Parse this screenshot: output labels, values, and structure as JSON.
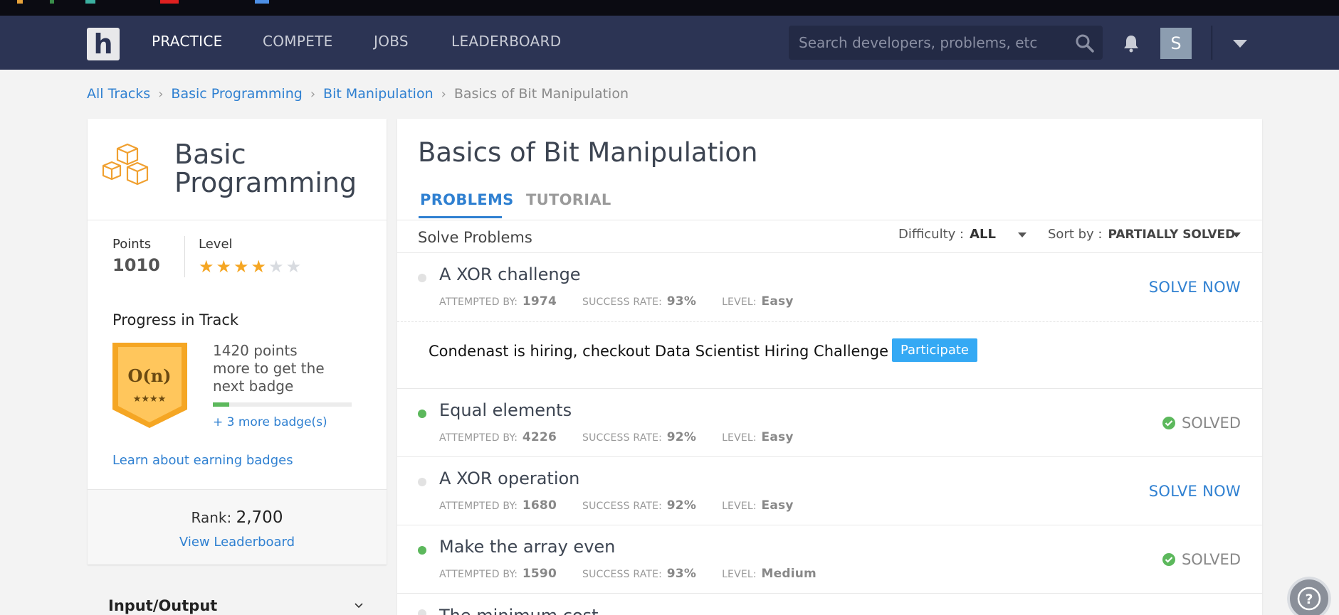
{
  "nav": {
    "logo_letter": "h",
    "items": [
      {
        "label": "PRACTICE",
        "active": true
      },
      {
        "label": "COMPETE",
        "active": false
      },
      {
        "label": "JOBS",
        "active": false
      },
      {
        "label": "LEADERBOARD",
        "active": false
      }
    ],
    "search_placeholder": "Search developers, problems, etc",
    "avatar_initial": "S"
  },
  "breadcrumb": {
    "items": [
      "All Tracks",
      "Basic Programming",
      "Bit Manipulation"
    ],
    "current": "Basics of Bit Manipulation"
  },
  "track": {
    "title_line1": "Basic",
    "title_line2": "Programming",
    "points_label": "Points",
    "points_value": "1010",
    "level_label": "Level",
    "level_stars_filled": 4,
    "level_stars_total": 6,
    "progress_title": "Progress in Track",
    "badge_text": "O(n)",
    "badge_stars": "★★★★",
    "points_more": "1420 points more to get the next badge",
    "progress_fraction": 0.12,
    "more_badges": "+ 3 more badge(s)",
    "learn_link": "Learn about earning badges",
    "rank_label": "Rank:",
    "rank_value": "2,700",
    "view_leaderboard": "View Leaderboard",
    "section_label": "Input/Output"
  },
  "main": {
    "title": "Basics of Bit Manipulation",
    "tabs": [
      {
        "label": "PROBLEMS",
        "active": true
      },
      {
        "label": "TUTORIAL",
        "active": false
      }
    ],
    "solve_problems": "Solve Problems",
    "difficulty_label": "Difficulty :",
    "difficulty_value": "ALL",
    "sort_label": "Sort by :",
    "sort_value": "PARTIALLY SOLVED",
    "meta_labels": {
      "attempted": "ATTEMPTED BY:",
      "success": "SUCCESS RATE:",
      "level": "LEVEL:"
    },
    "solve_now": "SOLVE NOW",
    "solved": "SOLVED",
    "problems": [
      {
        "name": "A XOR challenge",
        "attempted": "1974",
        "success": "93%",
        "level": "Easy",
        "status": "unsolved"
      },
      {
        "name": "Equal elements",
        "attempted": "4226",
        "success": "92%",
        "level": "Easy",
        "status": "solved"
      },
      {
        "name": "A XOR operation",
        "attempted": "1680",
        "success": "92%",
        "level": "Easy",
        "status": "unsolved"
      },
      {
        "name": "Make the array even",
        "attempted": "1590",
        "success": "93%",
        "level": "Medium",
        "status": "solved"
      }
    ],
    "partial_next": "The minimum cost",
    "ad": {
      "text": "Condenast is hiring, checkout Data Scientist Hiring Challenge",
      "button": "Participate"
    }
  },
  "colors": {
    "nav_bg": "#2c3454",
    "link": "#2f80d1",
    "accent_orange": "#f5a623",
    "success_green": "#5cb85c",
    "button_blue": "#34a9f4"
  }
}
